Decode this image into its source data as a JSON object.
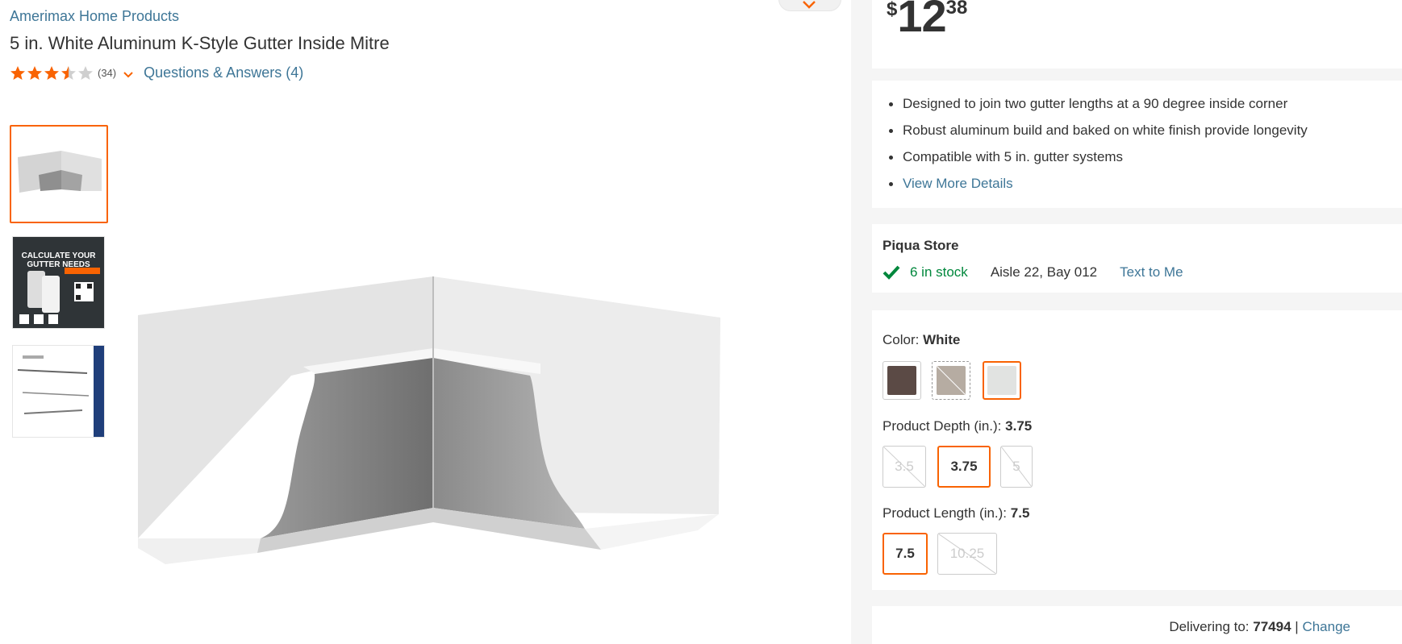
{
  "product": {
    "brand": "Amerimax Home Products",
    "title": "5 in. White Aluminum K-Style Gutter Inside Mitre",
    "rating": 3.5,
    "rating_max": 5,
    "review_count": "(34)",
    "qa_label": "Questions & Answers (4)"
  },
  "thumbnails": [
    {
      "name": "thumbnail-product-photo",
      "selected": true
    },
    {
      "name": "thumbnail-calculate-gutter-needs",
      "text": "CALCULATE YOUR GUTTER NEEDS",
      "selected": false
    },
    {
      "name": "thumbnail-installation-diagram",
      "selected": false
    }
  ],
  "price": {
    "dollar_sign": "$",
    "whole": "12",
    "cents": "38"
  },
  "highlights": [
    "Designed to join two gutter lengths at a 90 degree inside corner",
    "Robust aluminum build and baked on white finish provide longevity",
    "Compatible with 5 in. gutter systems"
  ],
  "view_more": "View More Details",
  "store": {
    "name": "Piqua Store",
    "stock": "6 in stock",
    "aisle": "Aisle 22, Bay 012",
    "text_me": "Text to Me"
  },
  "options": {
    "color": {
      "label": "Color:",
      "value": "White",
      "swatches": [
        {
          "name": "brown",
          "color": "#5b4a45",
          "selected": false,
          "unavailable": false
        },
        {
          "name": "tan",
          "color": "#b6aca2",
          "selected": false,
          "unavailable": true
        },
        {
          "name": "white",
          "color": "#e1e3e1",
          "selected": true,
          "unavailable": false
        }
      ]
    },
    "depth": {
      "label": "Product Depth (in.):",
      "value": "3.75",
      "choices": [
        {
          "label": "3.5",
          "selected": false,
          "unavailable": true
        },
        {
          "label": "3.75",
          "selected": true,
          "unavailable": false
        },
        {
          "label": "5",
          "selected": false,
          "unavailable": true
        }
      ]
    },
    "length": {
      "label": "Product Length (in.):",
      "value": "7.5",
      "choices": [
        {
          "label": "7.5",
          "selected": true,
          "unavailable": false
        },
        {
          "label": "10.25",
          "selected": false,
          "unavailable": true
        }
      ]
    }
  },
  "delivery": {
    "label": "Delivering to:",
    "zip": "77494",
    "separator": "|",
    "change": "Change"
  },
  "colors": {
    "brand_link": "#3e7697",
    "accent_orange": "#f96302",
    "in_stock_green": "#00873c"
  }
}
